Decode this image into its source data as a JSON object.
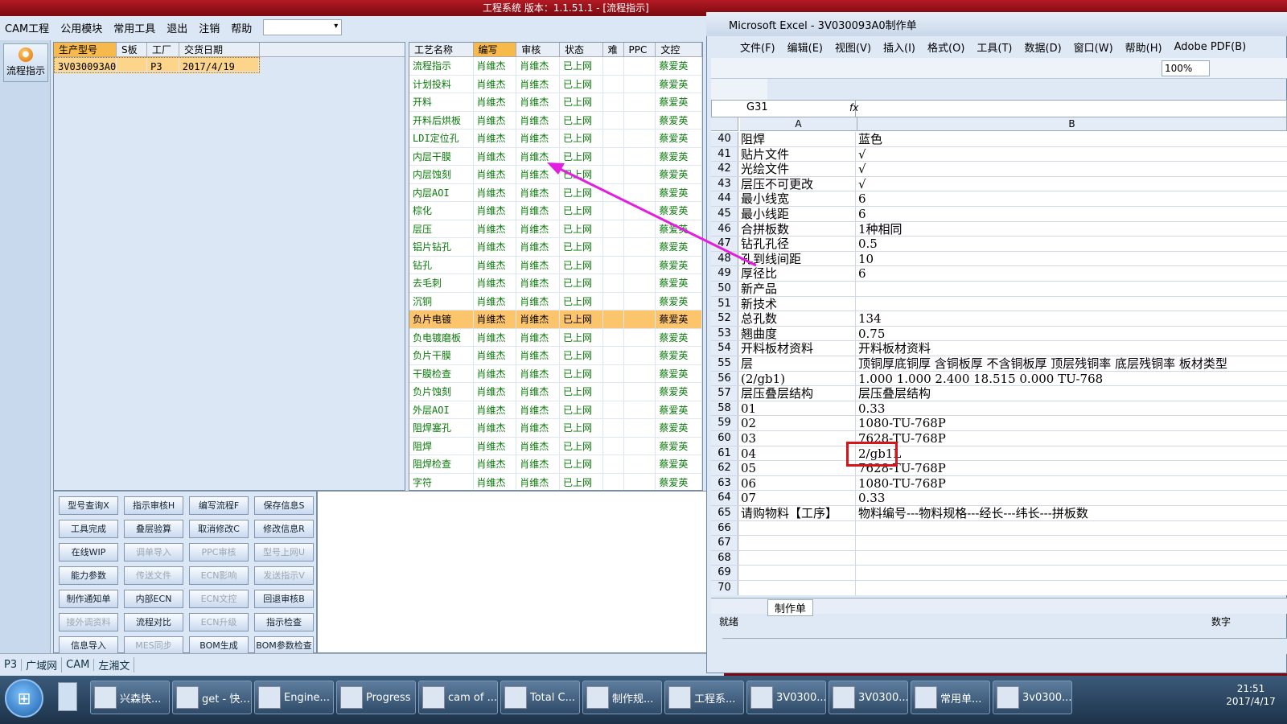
{
  "app": {
    "title": "工程系统 版本：1.1.51.1 - [流程指示]"
  },
  "menu": {
    "items": [
      "CAM工程",
      "公用模块",
      "常用工具",
      "退出",
      "注销",
      "帮助"
    ]
  },
  "side": {
    "flow_button": "流程指示"
  },
  "product": {
    "headers": [
      "生产型号",
      "S板",
      "工厂",
      "交货日期"
    ],
    "row": [
      "3V030093A0",
      "",
      "P3",
      "2017/4/19"
    ]
  },
  "process": {
    "headers": [
      "工艺名称",
      "编写",
      "审核",
      "状态",
      "难",
      "PPC",
      "文控"
    ],
    "rows": [
      [
        "流程指示",
        "肖维杰",
        "肖维杰",
        "已上网",
        "",
        "",
        "蔡爱英"
      ],
      [
        "计划投料",
        "肖维杰",
        "肖维杰",
        "已上网",
        "",
        "",
        "蔡爱英"
      ],
      [
        "开料",
        "肖维杰",
        "肖维杰",
        "已上网",
        "",
        "",
        "蔡爱英"
      ],
      [
        "开料后烘板",
        "肖维杰",
        "肖维杰",
        "已上网",
        "",
        "",
        "蔡爱英"
      ],
      [
        "LDI定位孔",
        "肖维杰",
        "肖维杰",
        "已上网",
        "",
        "",
        "蔡爱英"
      ],
      [
        "内层干膜",
        "肖维杰",
        "肖维杰",
        "已上网",
        "",
        "",
        "蔡爱英"
      ],
      [
        "内层蚀刻",
        "肖维杰",
        "肖维杰",
        "已上网",
        "",
        "",
        "蔡爱英"
      ],
      [
        "内层AOI",
        "肖维杰",
        "肖维杰",
        "已上网",
        "",
        "",
        "蔡爱英"
      ],
      [
        "棕化",
        "肖维杰",
        "肖维杰",
        "已上网",
        "",
        "",
        "蔡爱英"
      ],
      [
        "层压",
        "肖维杰",
        "肖维杰",
        "已上网",
        "",
        "",
        "蔡爱英"
      ],
      [
        "铝片钻孔",
        "肖维杰",
        "肖维杰",
        "已上网",
        "",
        "",
        "蔡爱英"
      ],
      [
        "钻孔",
        "肖维杰",
        "肖维杰",
        "已上网",
        "",
        "",
        "蔡爱英"
      ],
      [
        "去毛刺",
        "肖维杰",
        "肖维杰",
        "已上网",
        "",
        "",
        "蔡爱英"
      ],
      [
        "沉铜",
        "肖维杰",
        "肖维杰",
        "已上网",
        "",
        "",
        "蔡爱英"
      ],
      [
        "负片电镀",
        "肖维杰",
        "肖维杰",
        "已上网",
        "",
        "",
        "蔡爱英"
      ],
      [
        "负电镀磨板",
        "肖维杰",
        "肖维杰",
        "已上网",
        "",
        "",
        "蔡爱英"
      ],
      [
        "负片干膜",
        "肖维杰",
        "肖维杰",
        "已上网",
        "",
        "",
        "蔡爱英"
      ],
      [
        "干膜检查",
        "肖维杰",
        "肖维杰",
        "已上网",
        "",
        "",
        "蔡爱英"
      ],
      [
        "负片蚀刻",
        "肖维杰",
        "肖维杰",
        "已上网",
        "",
        "",
        "蔡爱英"
      ],
      [
        "外层AOI",
        "肖维杰",
        "肖维杰",
        "已上网",
        "",
        "",
        "蔡爱英"
      ],
      [
        "阻焊塞孔",
        "肖维杰",
        "肖维杰",
        "已上网",
        "",
        "",
        "蔡爱英"
      ],
      [
        "阻焊",
        "肖维杰",
        "肖维杰",
        "已上网",
        "",
        "",
        "蔡爱英"
      ],
      [
        "阻焊检查",
        "肖维杰",
        "肖维杰",
        "已上网",
        "",
        "",
        "蔡爱英"
      ],
      [
        "字符",
        "肖维杰",
        "肖维杰",
        "已上网",
        "",
        "",
        "蔡爱英"
      ]
    ],
    "selected": 14
  },
  "buttons": [
    [
      "型号查询X",
      "指示审核H",
      "编写流程F",
      "保存信息S"
    ],
    [
      "工具完成",
      "叠层验算",
      "取消修改C",
      "修改信息R"
    ],
    [
      "在线WIP",
      "调单导入",
      "PPC审核",
      "型号上网U"
    ],
    [
      "能力参数",
      "传送文件",
      "ECN影响",
      "发送指示V"
    ],
    [
      "制作通知单",
      "内部ECN",
      "ECN文控",
      "回退审核B"
    ],
    [
      "接外调资料",
      "流程对比",
      "ECN升级",
      "指示检查"
    ],
    [
      "信息导入",
      "MES同步",
      "BOM生成",
      "BOM参数检查"
    ]
  ],
  "buttons_disabled": [
    "调单导入",
    "PPC审核",
    "型号上网U",
    "传送文件",
    "ECN影响",
    "发送指示V",
    "ECN文控",
    "接外调资料",
    "ECN升级",
    "MES同步"
  ],
  "bottom": {
    "items": [
      "P3",
      "广域网",
      "CAM",
      "左湘文"
    ]
  },
  "excel": {
    "title": "Microsoft Excel - 3V030093A0制作单",
    "menu": [
      "文件(F)",
      "编辑(E)",
      "视图(V)",
      "插入(I)",
      "格式(O)",
      "工具(T)",
      "数据(D)",
      "窗口(W)",
      "帮助(H)",
      "Adobe PDF(B)"
    ],
    "zoom": "100%",
    "namebox": "G31",
    "fx": "fx",
    "col_a": "A",
    "col_b": "B",
    "rows": [
      [
        "40",
        "阻焊",
        "蓝色"
      ],
      [
        "41",
        "贴片文件",
        "√"
      ],
      [
        "42",
        "光绘文件",
        "√"
      ],
      [
        "43",
        "层压不可更改",
        "√"
      ],
      [
        "44",
        "最小线宽",
        "6"
      ],
      [
        "45",
        "最小线距",
        "6"
      ],
      [
        "46",
        "合拼板数",
        "1种相同"
      ],
      [
        "47",
        "钻孔孔径",
        "0.5"
      ],
      [
        "48",
        "孔到线间距",
        "10"
      ],
      [
        "49",
        "厚径比",
        "6"
      ],
      [
        "50",
        "新产品",
        ""
      ],
      [
        "51",
        "新技术",
        ""
      ],
      [
        "52",
        "总孔数",
        "134"
      ],
      [
        "53",
        "翘曲度",
        "0.75"
      ],
      [
        "54",
        "开料板材资料",
        "开料板材资料"
      ],
      [
        "55",
        "层",
        "顶铜厚底铜厚 含铜板厚 不含铜板厚 顶层残铜率 底层残铜率 板材类型"
      ],
      [
        "56",
        "(2/gb1)",
        "1.000  1.000   2.400               18.515    0.000        TU-768"
      ],
      [
        "57",
        "层压叠层结构",
        "层压叠层结构"
      ],
      [
        "58",
        "01",
        "0.33"
      ],
      [
        "59",
        "02",
        "1080-TU-768P"
      ],
      [
        "60",
        "03",
        "7628-TU-768P"
      ],
      [
        "61",
        "04",
        "2/gb1L"
      ],
      [
        "62",
        "05",
        "7628-TU-768P"
      ],
      [
        "63",
        "06",
        "1080-TU-768P"
      ],
      [
        "64",
        "07",
        "0.33"
      ],
      [
        "65",
        "请购物料【工序】",
        "物料编号---物料规格---经长---纬长---拼板数"
      ],
      [
        "66",
        "",
        ""
      ],
      [
        "67",
        "",
        ""
      ],
      [
        "68",
        "",
        ""
      ],
      [
        "69",
        "",
        ""
      ],
      [
        "70",
        "",
        ""
      ]
    ],
    "sheet_tab": "制作单",
    "status": "就绪",
    "status_right": "数字"
  },
  "taskbar": {
    "items": [
      "兴森快...",
      "get - 快...",
      "Engine...",
      "Progress",
      "cam of ...",
      "Total C...",
      "制作规...",
      "工程系...",
      "3V0300...",
      "3V0300...",
      "常用单...",
      "3v0300..."
    ],
    "time": "21:51",
    "date": "2017/4/17"
  }
}
